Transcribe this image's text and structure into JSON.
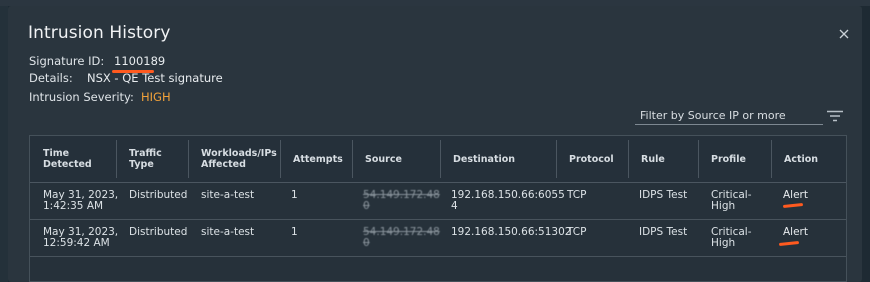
{
  "modal": {
    "title": "Intrusion History",
    "signature_label": "Signature ID:",
    "signature_id": "1100189",
    "details_label": "Details:",
    "details_value": "NSX - QE Test signature",
    "severity_label": "Intrusion Severity:",
    "severity_value": "HIGH"
  },
  "filter": {
    "placeholder": "Filter by Source IP or more"
  },
  "table": {
    "headers": [
      "Time Detected",
      "Traffic Type",
      "Workloads/IPs\nAffected",
      "Attempts",
      "Source",
      "Destination",
      "Protocol",
      "Rule",
      "Profile",
      "Action"
    ],
    "rows": [
      {
        "time": "May 31, 2023,\n1:42:35 AM",
        "traffic": "Distributed",
        "workloads": "site-a-test",
        "attempts": "1",
        "source": "54.149.172.48\n0",
        "destination": "192.168.150.66:6055\n4",
        "protocol": "TCP",
        "rule": "IDPS Test",
        "profile": "Critical-\nHigh",
        "action": "Alert"
      },
      {
        "time": "May 31, 2023,\n12:59:42 AM",
        "traffic": "Distributed",
        "workloads": "site-a-test",
        "attempts": "1",
        "source": "54.149.172.48\n0",
        "destination": "192.168.150.66:51302",
        "protocol": "TCP",
        "rule": "IDPS Test",
        "profile": "Critical-\nHigh",
        "action": "Alert"
      }
    ]
  },
  "colors": {
    "severity_high": "#f1a13a",
    "annotation": "#ff5a1f",
    "modal_bg": "#2a353e"
  }
}
